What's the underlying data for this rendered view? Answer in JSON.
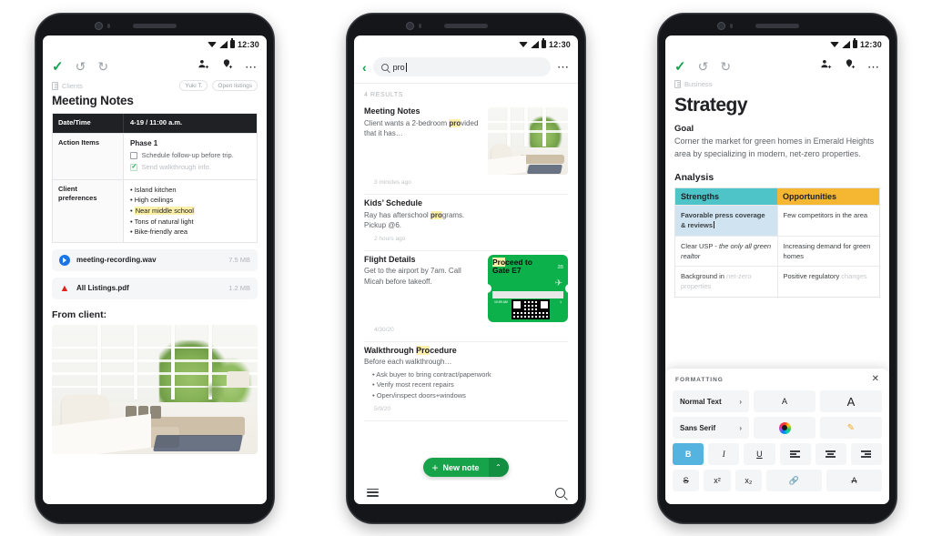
{
  "status_bar": {
    "time": "12:30",
    "icons": [
      "wifi-icon",
      "signal-icon",
      "battery-icon"
    ]
  },
  "brand": {
    "green": "#16a34a",
    "check_green": "#1aa251",
    "highlight_yellow": "#fdf0a8",
    "teal": "#4ec3c8",
    "amber": "#f5b731",
    "blue_sel": "#cfe4f0",
    "toggle_blue": "#55b3e0"
  },
  "phone1": {
    "toolbar": {
      "done": "✓",
      "undo": "↺",
      "redo": "↻",
      "add_person": "add-person-icon",
      "add_reminder": "add-reminder-icon",
      "overflow": "⋯"
    },
    "breadcrumb": {
      "notebook": "Clients"
    },
    "chips": [
      "Yuki T.",
      "Open listings"
    ],
    "title": "Meeting Notes",
    "table": [
      {
        "label": "Date/Time",
        "value": "4-19 / 11:00 a.m.",
        "dark": true
      },
      {
        "label": "Action Items",
        "phase": "Phase 1",
        "todos": [
          {
            "text": "Schedule follow-up before trip.",
            "done": false
          },
          {
            "text": "Send walkthrough info.",
            "done": true
          }
        ]
      },
      {
        "label": "Client preferences",
        "bullets": [
          {
            "text": "Island kitchen",
            "highlight": false
          },
          {
            "text": "High ceilings",
            "highlight": false
          },
          {
            "text": "Near middle school",
            "highlight": true
          },
          {
            "text": "Tons of natural light",
            "highlight": false
          },
          {
            "text": "Bike-friendly area",
            "highlight": false
          }
        ]
      }
    ],
    "attachments": [
      {
        "name": "meeting-recording.wav",
        "size": "7.5 MB",
        "icon": "play-icon"
      },
      {
        "name": "All Listings.pdf",
        "size": "1.2 MB",
        "icon": "pdf-icon"
      }
    ],
    "from_client_label": "From client:",
    "photo_alt": "living-room-photo"
  },
  "phone2": {
    "back": "‹",
    "search": {
      "value": "pro",
      "placeholder": "Search",
      "icon": "search-icon"
    },
    "overflow": "⋯",
    "results_label": "4 RESULTS",
    "results": [
      {
        "title": "Meeting Notes",
        "title_highlight": "",
        "body_pre": "Client wants a 2-bedroom ",
        "body_hl": "pro",
        "body_post": "vided that it has…",
        "time": "3 minutes ago",
        "thumb": "living-room-photo"
      },
      {
        "title": "Kids’ Schedule",
        "title_highlight": "",
        "body_pre": "Ray has afterschool ",
        "body_hl": "pro",
        "body_post": "grams. Pickup @6.",
        "time": "2 hours ago",
        "thumb": ""
      },
      {
        "title": "Flight Details",
        "title_highlight": "",
        "body_pre": "Get to the airport by 7am. Call Micah before takeoff.",
        "body_hl": "",
        "body_post": "",
        "time": "4/30/20",
        "thumb": "boarding-pass",
        "pass": {
          "line1_hl": "Pro",
          "line1_rest": "ceed to",
          "line2": "Gate E7",
          "seat": "2B",
          "meta": [
            "10:55 AM",
            "M62",
            "12",
            "1"
          ]
        }
      },
      {
        "title_pre": "Walkthrough ",
        "title_hl": "Pro",
        "title_post": "cedure",
        "body_pre": "Before each walkthrough…",
        "body_hl": "",
        "body_post": "",
        "bullets": [
          "Ask buyer to bring contract/paperwork",
          "Verify most recent repairs",
          "Open/inspect doors+windows"
        ],
        "time": "5/9/20",
        "thumb": ""
      }
    ],
    "new_note": {
      "label": "New note",
      "plus": "+",
      "caret": "⌃"
    },
    "bottom_bar": {
      "menu": "menu-icon",
      "search": "search-icon"
    }
  },
  "phone3": {
    "toolbar": {
      "done": "✓",
      "undo": "↺",
      "redo": "↻",
      "add_person": "add-person-icon",
      "add_reminder": "add-reminder-icon",
      "overflow": "⋯"
    },
    "breadcrumb": {
      "notebook": "Business"
    },
    "title": "Strategy",
    "goal": {
      "heading": "Goal",
      "text": "Corner the market for green homes in Emerald Heights area by specializing in modern, net-zero properties."
    },
    "analysis": {
      "heading": "Analysis",
      "columns": [
        "Strengths",
        "Opportunities"
      ],
      "rows": [
        {
          "strength": "Favorable press coverage & reviews",
          "strength_selected": true,
          "opportunity": "Few competitors in the area",
          "opportunity_green": false
        },
        {
          "strength_pre": "Clear USP - ",
          "strength_ital": "the only all green realtor",
          "strength_selected": false,
          "opportunity": "Increasing demand for green homes",
          "opportunity_green": true
        },
        {
          "strength_pre": "Background in ",
          "strength_faded": "net-zero properties",
          "strength_selected": false,
          "opportunity_pre": "Positive regulatory ",
          "opportunity_faded": "changes",
          "opportunity_green": false
        }
      ]
    },
    "formatting": {
      "title": "FORMATTING",
      "close": "✕",
      "style_label": "Normal Text",
      "font_label": "Sans Serif",
      "chevron": "›",
      "buttons": {
        "font_small": "A",
        "font_large": "A",
        "text_color": "color-wheel-icon",
        "highlight": "highlighter-icon",
        "bold": "B",
        "italic": "I",
        "underline": "U",
        "align_left": "align-left-icon",
        "align_center": "align-center-icon",
        "align_right": "align-right-icon",
        "strikethrough": "S",
        "superscript": "x²",
        "subscript": "x₂",
        "link": "link-icon",
        "clear_format": "clear-formatting-icon"
      },
      "bold_active": true
    }
  }
}
